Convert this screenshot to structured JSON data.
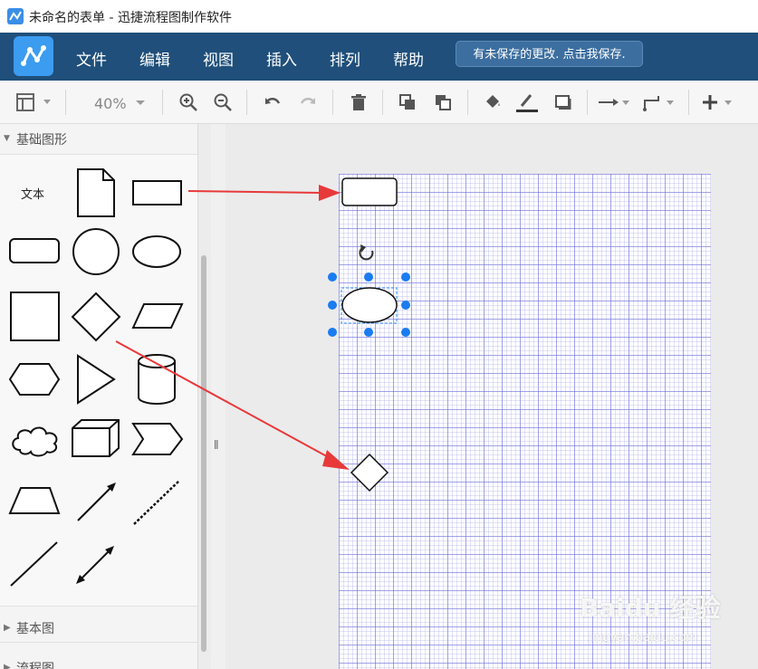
{
  "window": {
    "title": "未命名的表单 - 迅捷流程图制作软件"
  },
  "menu": {
    "items": [
      "文件",
      "编辑",
      "视图",
      "插入",
      "排列",
      "帮助"
    ],
    "save_notice": "有未保存的更改. 点击我保存."
  },
  "toolbar": {
    "zoom": "40%",
    "icons": [
      "layout-icon",
      "zoom-in-icon",
      "zoom-out-icon",
      "undo-icon",
      "redo-icon",
      "delete-icon",
      "bring-front-icon",
      "send-back-icon",
      "fill-color-icon",
      "line-color-icon",
      "shadow-icon",
      "connector-icon",
      "waypoint-icon",
      "add-icon"
    ]
  },
  "sidebar": {
    "sections": [
      {
        "label": "基础图形",
        "expanded": true
      },
      {
        "label": "基本图",
        "expanded": false
      },
      {
        "label": "流程图",
        "expanded": false
      }
    ],
    "text_shape_label": "文本"
  },
  "colors": {
    "menubar": "#1f4f7a",
    "accent": "#3b9cf0",
    "annotation_arrow": "#e8393a",
    "handle": "#1a7cf0",
    "grid": "#6e6edc"
  },
  "watermark": {
    "brand": "Baidu 经验",
    "url": "jingyan.baidu.com"
  }
}
